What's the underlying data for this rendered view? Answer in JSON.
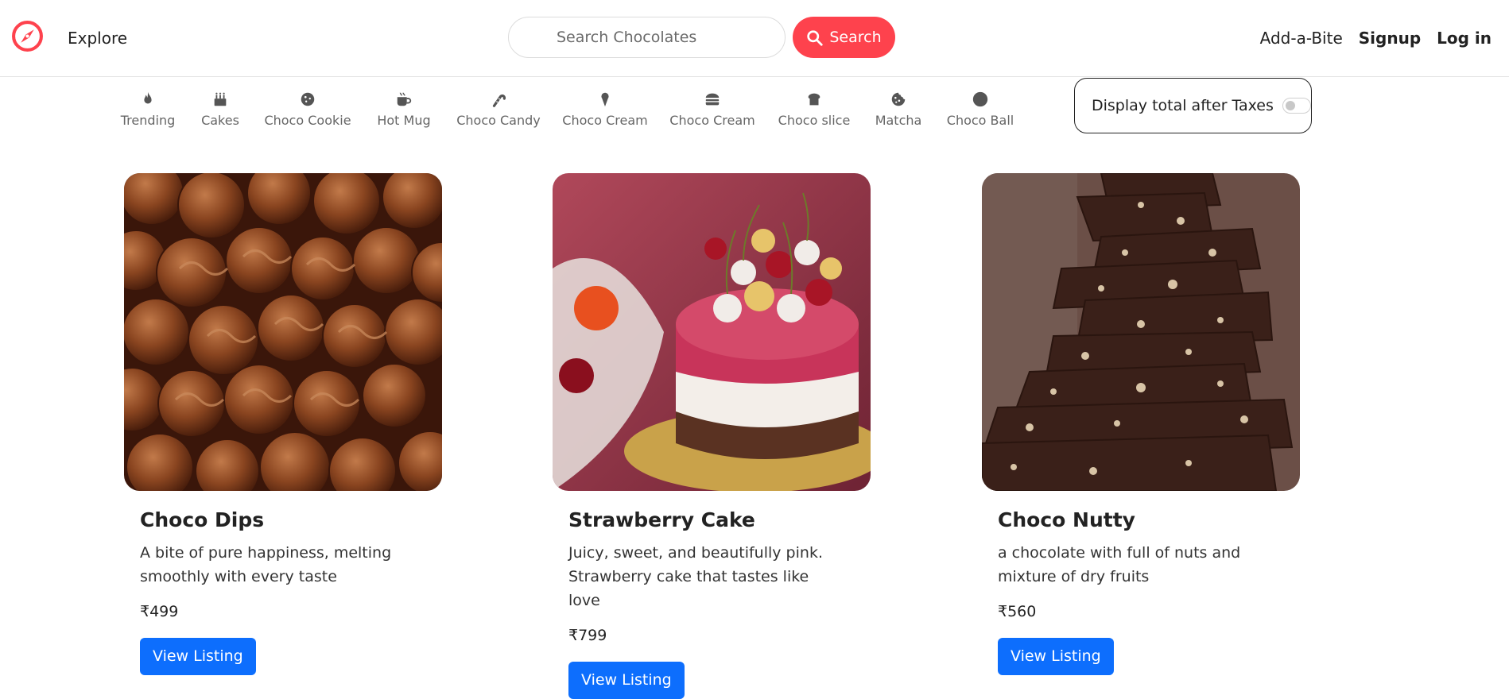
{
  "navbar": {
    "logo_icon": "compass-icon",
    "explore_label": "Explore",
    "search_placeholder": "Search Chocolates",
    "search_button_label": "Search",
    "add_a_bite_label": "Add-a-Bite",
    "signup_label": "Signup",
    "login_label": "Log in",
    "brand_color": "#fe424d"
  },
  "filters": [
    {
      "label": "Trending",
      "icon": "fire-icon"
    },
    {
      "label": "Cakes",
      "icon": "cake-icon"
    },
    {
      "label": "Choco Cookie",
      "icon": "cookie-icon"
    },
    {
      "label": "Hot Mug",
      "icon": "mug-icon"
    },
    {
      "label": "Choco Candy",
      "icon": "candy-cane-icon"
    },
    {
      "label": "Choco Cream",
      "icon": "ice-cream-icon"
    },
    {
      "label": "Choco Cream",
      "icon": "burger-icon"
    },
    {
      "label": "Choco slice",
      "icon": "bread-slice-icon"
    },
    {
      "label": "Matcha",
      "icon": "cookie-bite-icon"
    },
    {
      "label": "Choco Ball",
      "icon": "circle-icon"
    }
  ],
  "tax_toggle": {
    "label": "Display total after Taxes",
    "enabled": false
  },
  "listings": [
    {
      "title": "Choco Dips",
      "description": "A bite of pure happiness, melting smoothly with every taste",
      "price": "₹499",
      "button_label": "View Listing",
      "image": "chocolate-truffles-image"
    },
    {
      "title": "Strawberry Cake",
      "description": "Juicy, sweet, and beautifully pink. Strawberry cake that tastes like love",
      "price": "₹799",
      "button_label": "View Listing",
      "image": "cherry-cheesecake-image"
    },
    {
      "title": "Choco Nutty",
      "description": "a chocolate with full of nuts and mixture of dry fruits",
      "price": "₹560",
      "button_label": "View Listing",
      "image": "nut-chocolate-bar-image"
    }
  ]
}
